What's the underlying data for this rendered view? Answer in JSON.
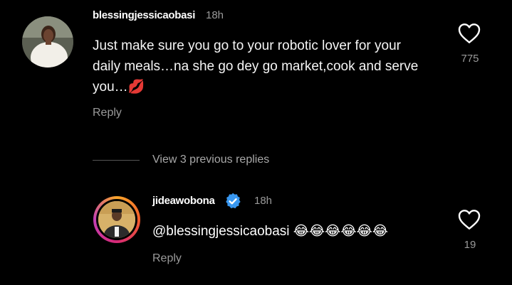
{
  "comment": {
    "username": "blessingjessicaobasi",
    "time": "18h",
    "text_lines": [
      "Just make sure you go to your robotic lover for your",
      "daily meals…na she go dey go market,cook and serve",
      "you…💋"
    ],
    "reply_label": "Reply",
    "likes": "775"
  },
  "view_replies": "View 3 previous replies",
  "reply": {
    "username": "jideawobona",
    "time": "18h",
    "text": "@blessingjessicaobasi 😂😂😂😂😂😂",
    "reply_label": "Reply",
    "likes": "19"
  },
  "colors": {
    "background": "#000000",
    "muted": "#9a9a9a",
    "verified": "#3897f0"
  },
  "icons": [
    "heart-outline-icon",
    "verified-badge-icon"
  ]
}
